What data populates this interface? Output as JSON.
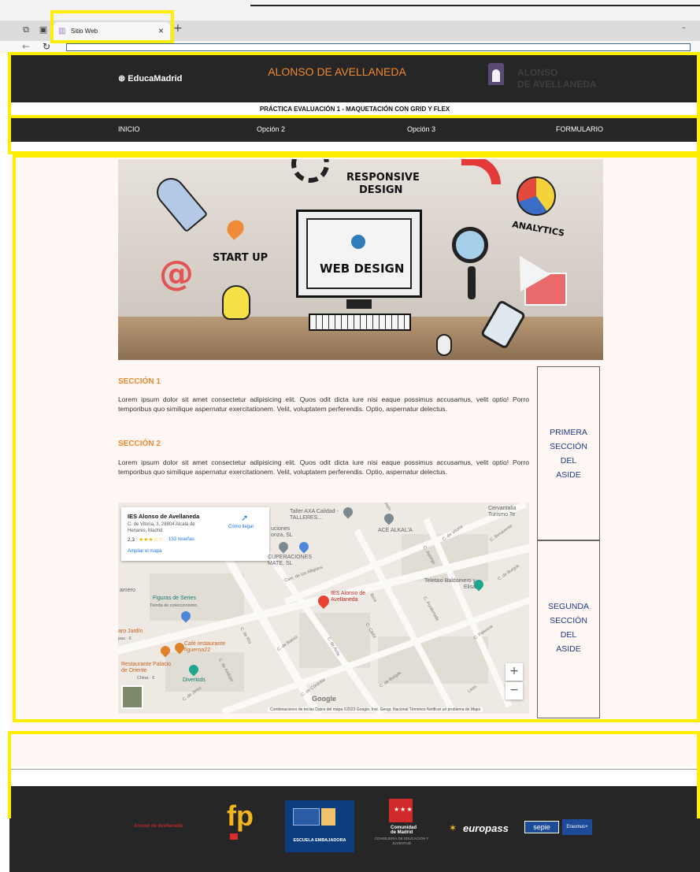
{
  "browser": {
    "tab_title": "Sitio Web",
    "tab_close": "×",
    "new_tab": "+",
    "minimize": "–"
  },
  "header": {
    "educa_logo": "EducaMadrid",
    "title": "ALONSO DE AVELLANEDA",
    "logo_line1": "ALONSO",
    "logo_line2": "DE AVELLANEDA",
    "subtitle": "PRÁCTICA EVALUACIÓN 1 - MAQUETACIÓN CON GRID Y FLEX"
  },
  "nav": {
    "items": [
      "INICIO",
      "Opción 2",
      "Opción 3",
      "FORMULARIO"
    ]
  },
  "hero": {
    "labels": {
      "responsive": "RESPONSIVE",
      "design": "DESIGN",
      "analytics": "ANALYTICS",
      "startup": "START UP",
      "webdesign": "WEB DESIGN"
    }
  },
  "sections": [
    {
      "title": "SECCIÓN 1",
      "text": "Lorem ipsum dolor sit amet consectetur adipisicing elit. Quos odit dicta iure nisi eaque possimus accusamus, velit optio! Porro temporibus quo similique aspernatur exercitationem. Velit, voluptatem perferendis. Optio, aspernatur delectus."
    },
    {
      "title": "SECCIÓN 2",
      "text": "Lorem ipsum dolor sit amet consectetur adipisicing elit. Quos odit dicta iure nisi eaque possimus accusamus, velit optio! Porro temporibus quo similique aspernatur exercitationem. Velit, voluptatem perferendis. Optio, aspernatur delectus."
    }
  ],
  "map": {
    "place_name": "IES Alonso de Avellaneda",
    "address": "C. de Vitoria, 3, 28804 Alcalá de Henares, Madrid",
    "rating": "2,3",
    "stars": "★★★☆☆",
    "reviews": "133 reseñas",
    "enlarge": "Ampliar el mapa",
    "directions": "Cómo llegar",
    "marker_label": "IES Alonso de Avellaneda",
    "labels": {
      "taller": "Taller AXA Calidad - TALLERES...",
      "ace": "ACE ALKAL'A",
      "cervantalia": "Cervantalia Turismo Te",
      "soluciones": "uciones onza, SL",
      "recuperaciones": "CUPERACIONES MATE, SL",
      "figuras": "Figuras de Series",
      "figuras_sub": "Tienda de coleccionismo",
      "teletaxi": "Teletaxi Baldomero y Elisa",
      "cafe": "Café restaurante figueroa22",
      "restaurante": "Restaurante Palacio de Oriente",
      "restaurante_sub": "China · €",
      "diverkids": "Diverkids",
      "jardin": "aro Jardín",
      "jardin_sub": "pas · €",
      "amero": "amero"
    },
    "streets": {
      "vitoria": "C. de Vitoria",
      "vitoria2": "C. de Vitoria",
      "benavente": "C. Benavente",
      "astorga": "C. Astorga",
      "burgos": "C. de Burgos",
      "burgos2": "C. de Burgos",
      "ponferrada": "C. Ponferrada",
      "palencia": "C. Palencia",
      "leon": "León",
      "afligidos": "Cam. de los Afligidos",
      "avila": "C. de Ávila",
      "baeza": "C. de Baeza",
      "cadiz": "C. Cádiz",
      "ibiza": "Ibiza",
      "rio": "C. de Río",
      "andujar": "C. de Andújar",
      "jerez": "C. de Jerez",
      "cordoba": "C. de Córdoba",
      "jaen": "Jaén"
    },
    "zoom_in": "+",
    "zoom_out": "−",
    "google": "Google",
    "footer_text": "Combinaciones de teclas   Datos del mapa ©2023 Google, Inst. Geogr. Nacional   Términos   Notificar un problema de Maps"
  },
  "aside": {
    "first": [
      "PRIMERA",
      "SECCIÓN",
      "DEL",
      "ASIDE"
    ],
    "second": [
      "SEGUNDA",
      "SECCIÓN",
      "DEL",
      "ASIDE"
    ]
  },
  "footer_logos": {
    "alonso": "Alonso de Avellaneda",
    "fp": "fp",
    "escuela": "ESCUELA EMBAJADORA",
    "comunidad_line1": "Comunidad",
    "comunidad_line2": "de Madrid",
    "comunidad_line3": "CONSEJERÍA DE EDUCACIÓN Y JUVENTUD",
    "europass": "europass",
    "sepie": "sepie",
    "erasmus": "Erasmus+"
  },
  "colors": {
    "header_bg": "#262626",
    "accent": "#f0892e",
    "aside_text": "#1f3a86",
    "highlight": "#ffee00",
    "page_bg": "#fff7f4"
  }
}
